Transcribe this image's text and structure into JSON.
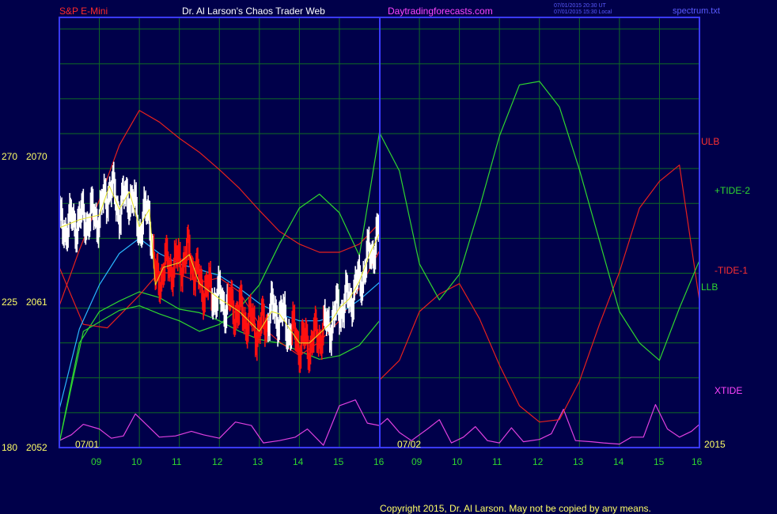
{
  "header": {
    "instrument": "S&P E-Mini",
    "title": "Dr. Al Larson's Chaos Trader Web",
    "site": "Daytradingforecasts.com",
    "stamp_utc": "07/01/2015 20:30 UT",
    "stamp_local": "07/01/2015 15:30 Local",
    "filename": "spectrum.txt"
  },
  "footer": {
    "copyright": "Copyright 2015, Dr. Al Larson. May not be copied by any means."
  },
  "colors": {
    "background": "#00004a",
    "frame": "#3a3aff",
    "grid": "#0f6b24",
    "price": "#ffffff",
    "price_down": "#ff1010",
    "red": "#e8201c",
    "green": "#2fd62f",
    "cyan": "#29b7ff",
    "yellow": "#e6e620",
    "magenta": "#e040e0",
    "hour_labels": "#2fd62f",
    "date_labels": "#ffff66"
  },
  "chart_data": {
    "type": "line",
    "title": "S&P E-Mini",
    "y_ticks": [
      {
        "left": "270",
        "right": "2070"
      },
      {
        "left": "225",
        "right": "2061"
      },
      {
        "left": "180",
        "right": "2052"
      }
    ],
    "ylim": [
      2052,
      2089
    ],
    "x_hours_day1": [
      "09",
      "10",
      "11",
      "12",
      "13",
      "14",
      "15",
      "16"
    ],
    "x_hours_day2": [
      "09",
      "10",
      "11",
      "12",
      "13",
      "14",
      "15",
      "16"
    ],
    "date_labels": [
      "07/01",
      "07/02",
      "2015"
    ],
    "xlim": [
      8.0,
      24.0
    ],
    "series_labels": {
      "ulb": "ULB",
      "tide_plus": "+TIDE-2",
      "tide_minus": "-TIDE-1",
      "llb": "LLB",
      "xtide": "XTIDE"
    },
    "upper_band": [
      [
        8.0,
        2064.2
      ],
      [
        8.5,
        2069.0
      ],
      [
        9.0,
        2073.3
      ],
      [
        9.5,
        2078.0
      ],
      [
        10.0,
        2081.0
      ],
      [
        10.5,
        2080.0
      ],
      [
        11.0,
        2078.6
      ],
      [
        11.5,
        2077.4
      ],
      [
        12.0,
        2075.9
      ],
      [
        12.5,
        2074.3
      ],
      [
        13.0,
        2072.4
      ],
      [
        13.5,
        2070.6
      ],
      [
        14.0,
        2069.5
      ],
      [
        14.5,
        2068.8
      ],
      [
        15.0,
        2068.8
      ],
      [
        15.5,
        2069.5
      ],
      [
        16.0,
        2071.3
      ]
    ],
    "lower_band": [
      [
        8.0,
        2052.4
      ],
      [
        8.5,
        2061.0
      ],
      [
        9.0,
        2063.7
      ],
      [
        9.5,
        2064.6
      ],
      [
        10.0,
        2065.4
      ],
      [
        10.5,
        2064.9
      ],
      [
        11.0,
        2063.9
      ],
      [
        11.5,
        2063.6
      ],
      [
        12.0,
        2062.9
      ],
      [
        12.5,
        2062.0
      ],
      [
        13.0,
        2061.3
      ],
      [
        13.5,
        2061.0
      ],
      [
        14.0,
        2060.3
      ],
      [
        14.5,
        2059.6
      ],
      [
        15.0,
        2059.9
      ],
      [
        15.5,
        2060.8
      ],
      [
        16.0,
        2062.9
      ]
    ],
    "tide_minus_1": [
      [
        8.0,
        2067.5
      ],
      [
        8.6,
        2062.6
      ],
      [
        9.2,
        2062.3
      ],
      [
        10.0,
        2065.1
      ],
      [
        10.5,
        2067.1
      ],
      [
        11.0,
        2066.9
      ],
      [
        11.5,
        2066.2
      ],
      [
        12.0,
        2066.6
      ],
      [
        12.5,
        2065.4
      ],
      [
        13.0,
        2062.6
      ],
      [
        13.5,
        2061.1
      ],
      [
        14.0,
        2059.9
      ],
      [
        14.5,
        2061.1
      ],
      [
        15.0,
        2062.9
      ],
      [
        15.5,
        2065.7
      ],
      [
        16.0,
        2068.9
      ],
      [
        16.0,
        2057.8
      ],
      [
        16.5,
        2059.5
      ],
      [
        17.0,
        2063.7
      ],
      [
        17.5,
        2065.2
      ],
      [
        18.0,
        2066.1
      ],
      [
        18.5,
        2063.1
      ],
      [
        19.0,
        2059.1
      ],
      [
        19.5,
        2055.6
      ],
      [
        20.0,
        2054.2
      ],
      [
        20.5,
        2054.4
      ],
      [
        21.0,
        2057.7
      ],
      [
        21.5,
        2062.6
      ],
      [
        22.0,
        2067.1
      ],
      [
        22.5,
        2072.6
      ],
      [
        23.0,
        2074.9
      ],
      [
        23.5,
        2076.3
      ],
      [
        24.0,
        2064.6
      ]
    ],
    "tide_plus_2": [
      [
        8.0,
        2052.4
      ],
      [
        8.6,
        2062.0
      ],
      [
        9.5,
        2063.8
      ],
      [
        10.0,
        2064.2
      ],
      [
        10.5,
        2063.5
      ],
      [
        11.0,
        2062.9
      ],
      [
        11.5,
        2062.0
      ],
      [
        12.0,
        2062.6
      ],
      [
        12.5,
        2064.0
      ],
      [
        13.0,
        2066.0
      ],
      [
        13.5,
        2069.5
      ],
      [
        14.0,
        2072.6
      ],
      [
        14.5,
        2073.8
      ],
      [
        15.0,
        2072.2
      ],
      [
        15.5,
        2068.5
      ],
      [
        16.0,
        2079.1
      ],
      [
        16.5,
        2075.8
      ],
      [
        17.0,
        2067.8
      ],
      [
        17.5,
        2064.7
      ],
      [
        18.0,
        2066.9
      ],
      [
        18.5,
        2072.6
      ],
      [
        19.0,
        2078.8
      ],
      [
        19.5,
        2083.2
      ],
      [
        20.0,
        2083.5
      ],
      [
        20.5,
        2081.3
      ],
      [
        21.0,
        2075.9
      ],
      [
        21.5,
        2069.8
      ],
      [
        22.0,
        2063.7
      ],
      [
        22.5,
        2061.0
      ],
      [
        23.0,
        2059.5
      ],
      [
        23.5,
        2064.0
      ],
      [
        24.0,
        2068.1
      ]
    ],
    "mov_avg_cyan": [
      [
        8.0,
        2055.3
      ],
      [
        8.5,
        2062.2
      ],
      [
        9.0,
        2066.0
      ],
      [
        9.5,
        2068.7
      ],
      [
        10.0,
        2070.0
      ],
      [
        10.5,
        2068.7
      ],
      [
        11.0,
        2067.8
      ],
      [
        11.5,
        2067.3
      ],
      [
        12.0,
        2066.8
      ],
      [
        12.5,
        2065.7
      ],
      [
        13.0,
        2064.4
      ],
      [
        13.5,
        2063.5
      ],
      [
        14.0,
        2062.9
      ],
      [
        14.5,
        2062.9
      ],
      [
        15.0,
        2063.5
      ],
      [
        15.5,
        2064.7
      ],
      [
        16.0,
        2066.2
      ]
    ],
    "price_close": [
      [
        8.0,
        2070.9
      ],
      [
        8.5,
        2071.6
      ],
      [
        9.0,
        2072.0
      ],
      [
        9.25,
        2074.5
      ],
      [
        9.5,
        2072.5
      ],
      [
        9.75,
        2074.0
      ],
      [
        10.0,
        2071.0
      ],
      [
        10.25,
        2072.5
      ],
      [
        10.4,
        2066.0
      ],
      [
        10.6,
        2067.5
      ],
      [
        11.0,
        2067.9
      ],
      [
        11.25,
        2068.6
      ],
      [
        11.5,
        2066.1
      ],
      [
        12.0,
        2064.8
      ],
      [
        12.5,
        2063.7
      ],
      [
        13.0,
        2062.0
      ],
      [
        13.3,
        2063.7
      ],
      [
        13.5,
        2063.5
      ],
      [
        14.0,
        2061.0
      ],
      [
        14.25,
        2061.0
      ],
      [
        14.5,
        2061.8
      ],
      [
        14.75,
        2062.6
      ],
      [
        15.0,
        2064.0
      ],
      [
        15.25,
        2064.8
      ],
      [
        15.5,
        2066.3
      ],
      [
        15.75,
        2068.6
      ],
      [
        16.0,
        2070.4
      ]
    ],
    "xtide": [
      [
        8.0,
        2052.6
      ],
      [
        8.3,
        2053.1
      ],
      [
        8.6,
        2054.0
      ],
      [
        9.0,
        2053.6
      ],
      [
        9.3,
        2052.8
      ],
      [
        9.6,
        2053.0
      ],
      [
        9.9,
        2054.9
      ],
      [
        10.2,
        2053.9
      ],
      [
        10.5,
        2052.9
      ],
      [
        10.9,
        2053.0
      ],
      [
        11.3,
        2053.4
      ],
      [
        11.6,
        2053.1
      ],
      [
        12.0,
        2052.8
      ],
      [
        12.4,
        2054.2
      ],
      [
        12.8,
        2053.9
      ],
      [
        13.1,
        2052.4
      ],
      [
        13.5,
        2052.6
      ],
      [
        13.9,
        2052.9
      ],
      [
        14.2,
        2053.6
      ],
      [
        14.6,
        2052.2
      ],
      [
        15.0,
        2055.6
      ],
      [
        15.4,
        2056.1
      ],
      [
        15.7,
        2054.1
      ],
      [
        16.0,
        2053.9
      ],
      [
        16.2,
        2054.5
      ],
      [
        16.5,
        2053.3
      ],
      [
        16.8,
        2052.6
      ],
      [
        17.2,
        2053.6
      ],
      [
        17.5,
        2054.4
      ],
      [
        17.8,
        2052.4
      ],
      [
        18.1,
        2052.9
      ],
      [
        18.4,
        2053.8
      ],
      [
        18.7,
        2052.6
      ],
      [
        19.0,
        2052.4
      ],
      [
        19.3,
        2053.7
      ],
      [
        19.6,
        2052.5
      ],
      [
        20.0,
        2052.7
      ],
      [
        20.3,
        2053.2
      ],
      [
        20.6,
        2055.3
      ],
      [
        20.9,
        2052.6
      ],
      [
        21.3,
        2052.5
      ],
      [
        21.6,
        2052.4
      ],
      [
        22.0,
        2052.3
      ],
      [
        22.3,
        2052.9
      ],
      [
        22.6,
        2052.9
      ],
      [
        22.9,
        2055.7
      ],
      [
        23.2,
        2053.6
      ],
      [
        23.5,
        2052.9
      ],
      [
        23.8,
        2053.4
      ],
      [
        24.0,
        2054.0
      ]
    ]
  }
}
